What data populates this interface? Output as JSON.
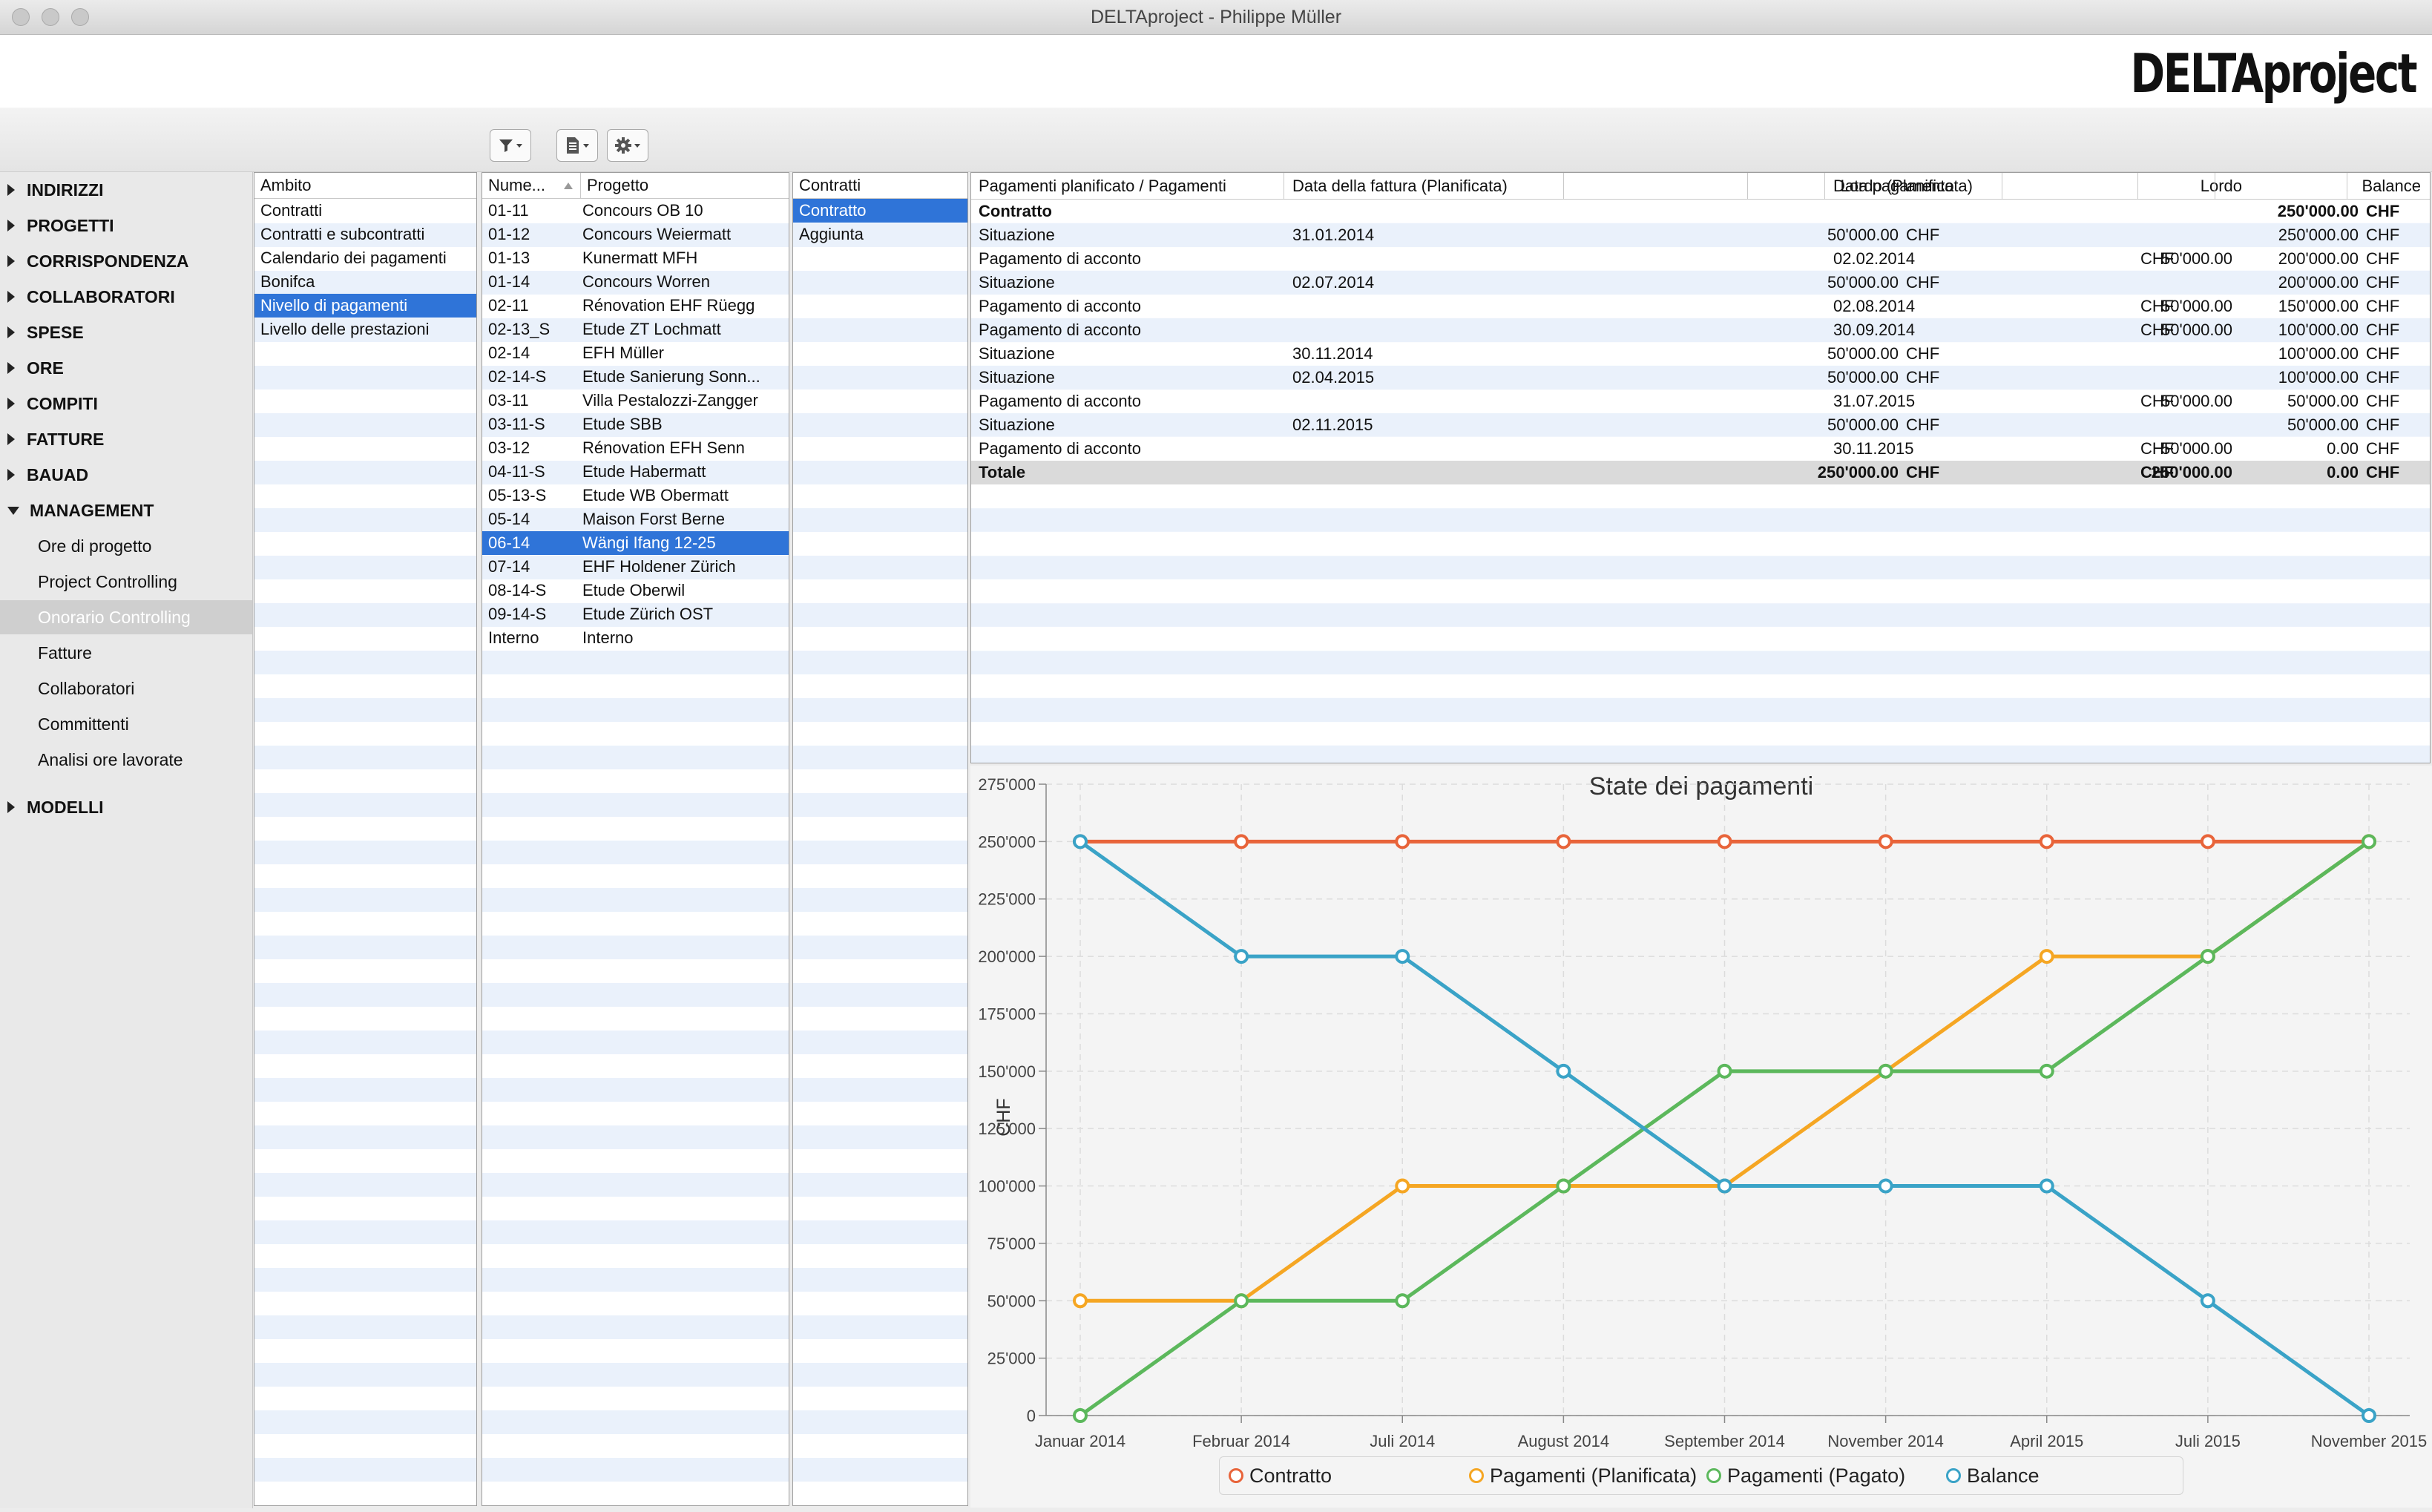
{
  "window": {
    "title": "DELTAproject - Philippe Müller",
    "logo": "DELTAproject"
  },
  "toolbar": {
    "buttons": [
      "filter-icon",
      "document-icon",
      "gear-icon"
    ]
  },
  "sidebar": {
    "sections": [
      {
        "label": "INDIRIZZI"
      },
      {
        "label": "PROGETTI"
      },
      {
        "label": "CORRISPONDENZA"
      },
      {
        "label": "COLLABORATORI"
      },
      {
        "label": "SPESE"
      },
      {
        "label": "ORE"
      },
      {
        "label": "COMPITI"
      },
      {
        "label": "FATTURE"
      },
      {
        "label": "BAUAD"
      },
      {
        "label": "MANAGEMENT"
      }
    ],
    "management_items": [
      {
        "label": "Ore di progetto"
      },
      {
        "label": "Project Controlling"
      },
      {
        "label": "Onorario Controlling"
      },
      {
        "label": "Fatture"
      },
      {
        "label": "Collaboratori"
      },
      {
        "label": "Committenti"
      },
      {
        "label": "Analisi ore lavorate"
      }
    ],
    "last_section": {
      "label": "MODELLI"
    }
  },
  "ambito": {
    "header": "Ambito",
    "items": [
      "Contratti",
      "Contratti e subcontratti",
      "Calendario dei pagamenti",
      "Bonifca",
      "Nivello di pagamenti",
      "Livello delle prestazioni"
    ],
    "selected": "Nivello di pagamenti"
  },
  "projects": {
    "header_num": "Nume...",
    "header_name": "Progetto",
    "rows": [
      {
        "num": "01-11",
        "name": "Concours OB 10"
      },
      {
        "num": "01-12",
        "name": "Concours Weiermatt"
      },
      {
        "num": "01-13",
        "name": "Kunermatt MFH"
      },
      {
        "num": "01-14",
        "name": "Concours Worren"
      },
      {
        "num": "02-11",
        "name": "Rénovation EHF Rüegg"
      },
      {
        "num": "02-13_S",
        "name": "Etude ZT Lochmatt"
      },
      {
        "num": "02-14",
        "name": "EFH Müller"
      },
      {
        "num": "02-14-S",
        "name": "Etude Sanierung Sonn..."
      },
      {
        "num": "03-11",
        "name": "Villa Pestalozzi-Zangger"
      },
      {
        "num": "03-11-S",
        "name": "Etude SBB"
      },
      {
        "num": "03-12",
        "name": "Rénovation EFH Senn"
      },
      {
        "num": "04-11-S",
        "name": "Etude Habermatt"
      },
      {
        "num": "05-13-S",
        "name": "Etude WB Obermatt"
      },
      {
        "num": "05-14",
        "name": "Maison Forst Berne"
      },
      {
        "num": "06-14",
        "name": "Wängi Ifang 12-25"
      },
      {
        "num": "07-14",
        "name": "EHF Holdener Zürich"
      },
      {
        "num": "08-14-S",
        "name": "Etude Oberwil"
      },
      {
        "num": "09-14-S",
        "name": "Etude Zürich OST"
      },
      {
        "num": "Interno",
        "name": "Interno"
      }
    ],
    "selected_num": "06-14"
  },
  "contratti": {
    "header": "Contratti",
    "items": [
      "Contratto",
      "Aggiunta"
    ],
    "selected": "Contratto"
  },
  "payments": {
    "headers": [
      "Pagamenti planificato / Pagamenti",
      "Data della fattura (Planificata)",
      "Lordo (Planificata)",
      "Data pagamento",
      "Lordo",
      "Balance"
    ],
    "rows": [
      {
        "type": "Contratto",
        "inv_date": "",
        "planned": "",
        "planned_cur": "",
        "pay_date": "",
        "gross": "",
        "gross_cur": "",
        "balance": "250'000.00",
        "balance_cur": "CHF",
        "bold": true
      },
      {
        "type": "Situazione",
        "inv_date": "31.01.2014",
        "planned": "50'000.00",
        "planned_cur": "CHF",
        "pay_date": "",
        "gross": "",
        "gross_cur": "",
        "balance": "250'000.00",
        "balance_cur": "CHF"
      },
      {
        "type": "Pagamento di acconto",
        "inv_date": "",
        "planned": "",
        "planned_cur": "",
        "pay_date": "02.02.2014",
        "gross": "50'000.00",
        "gross_cur": "CHF",
        "balance": "200'000.00",
        "balance_cur": "CHF"
      },
      {
        "type": "Situazione",
        "inv_date": "02.07.2014",
        "planned": "50'000.00",
        "planned_cur": "CHF",
        "pay_date": "",
        "gross": "",
        "gross_cur": "",
        "balance": "200'000.00",
        "balance_cur": "CHF"
      },
      {
        "type": "Pagamento di acconto",
        "inv_date": "",
        "planned": "",
        "planned_cur": "",
        "pay_date": "02.08.2014",
        "gross": "50'000.00",
        "gross_cur": "CHF",
        "balance": "150'000.00",
        "balance_cur": "CHF"
      },
      {
        "type": "Pagamento di acconto",
        "inv_date": "",
        "planned": "",
        "planned_cur": "",
        "pay_date": "30.09.2014",
        "gross": "50'000.00",
        "gross_cur": "CHF",
        "balance": "100'000.00",
        "balance_cur": "CHF"
      },
      {
        "type": "Situazione",
        "inv_date": "30.11.2014",
        "planned": "50'000.00",
        "planned_cur": "CHF",
        "pay_date": "",
        "gross": "",
        "gross_cur": "",
        "balance": "100'000.00",
        "balance_cur": "CHF"
      },
      {
        "type": "Situazione",
        "inv_date": "02.04.2015",
        "planned": "50'000.00",
        "planned_cur": "CHF",
        "pay_date": "",
        "gross": "",
        "gross_cur": "",
        "balance": "100'000.00",
        "balance_cur": "CHF"
      },
      {
        "type": "Pagamento di acconto",
        "inv_date": "",
        "planned": "",
        "planned_cur": "",
        "pay_date": "31.07.2015",
        "gross": "50'000.00",
        "gross_cur": "CHF",
        "balance": "50'000.00",
        "balance_cur": "CHF"
      },
      {
        "type": "Situazione",
        "inv_date": "02.11.2015",
        "planned": "50'000.00",
        "planned_cur": "CHF",
        "pay_date": "",
        "gross": "",
        "gross_cur": "",
        "balance": "50'000.00",
        "balance_cur": "CHF"
      },
      {
        "type": "Pagamento di acconto",
        "inv_date": "",
        "planned": "",
        "planned_cur": "",
        "pay_date": "30.11.2015",
        "gross": "50'000.00",
        "gross_cur": "CHF",
        "balance": "0.00",
        "balance_cur": "CHF"
      },
      {
        "type": "Totale",
        "inv_date": "",
        "planned": "250'000.00",
        "planned_cur": "CHF",
        "pay_date": "",
        "gross": "250'000.00",
        "gross_cur": "CHF",
        "balance": "0.00",
        "balance_cur": "CHF",
        "total": true
      }
    ]
  },
  "colors": {
    "selection": "#2f74d8",
    "contratto": "#e8643a",
    "planned": "#f5a623",
    "paid": "#5cb85c",
    "balance": "#3aa3c7"
  },
  "chart_data": {
    "type": "line",
    "title": "State dei pagamenti",
    "ylabel": "CHF",
    "xlabel": "",
    "categories": [
      "Januar 2014",
      "Februar 2014",
      "Juli 2014",
      "August 2014",
      "September 2014",
      "November 2014",
      "April 2015",
      "Juli 2015",
      "November 2015"
    ],
    "ylim": [
      0,
      275000
    ],
    "yticks": [
      "0",
      "25'000",
      "50'000",
      "75'000",
      "100'000",
      "125'000",
      "150'000",
      "175'000",
      "200'000",
      "225'000",
      "250'000",
      "275'000"
    ],
    "grid": true,
    "legend_position": "bottom",
    "series": [
      {
        "name": "Contratto",
        "color": "#e8643a",
        "values": [
          250000,
          250000,
          250000,
          250000,
          250000,
          250000,
          250000,
          250000,
          250000
        ]
      },
      {
        "name": "Pagamenti (Planificata)",
        "color": "#f5a623",
        "values": [
          50000,
          50000,
          100000,
          100000,
          100000,
          150000,
          200000,
          200000,
          250000
        ]
      },
      {
        "name": "Pagamenti (Pagato)",
        "color": "#5cb85c",
        "values": [
          0,
          50000,
          50000,
          100000,
          150000,
          150000,
          150000,
          200000,
          250000
        ]
      },
      {
        "name": "Balance",
        "color": "#3aa3c7",
        "values": [
          250000,
          200000,
          200000,
          150000,
          100000,
          100000,
          100000,
          50000,
          0
        ]
      }
    ]
  }
}
